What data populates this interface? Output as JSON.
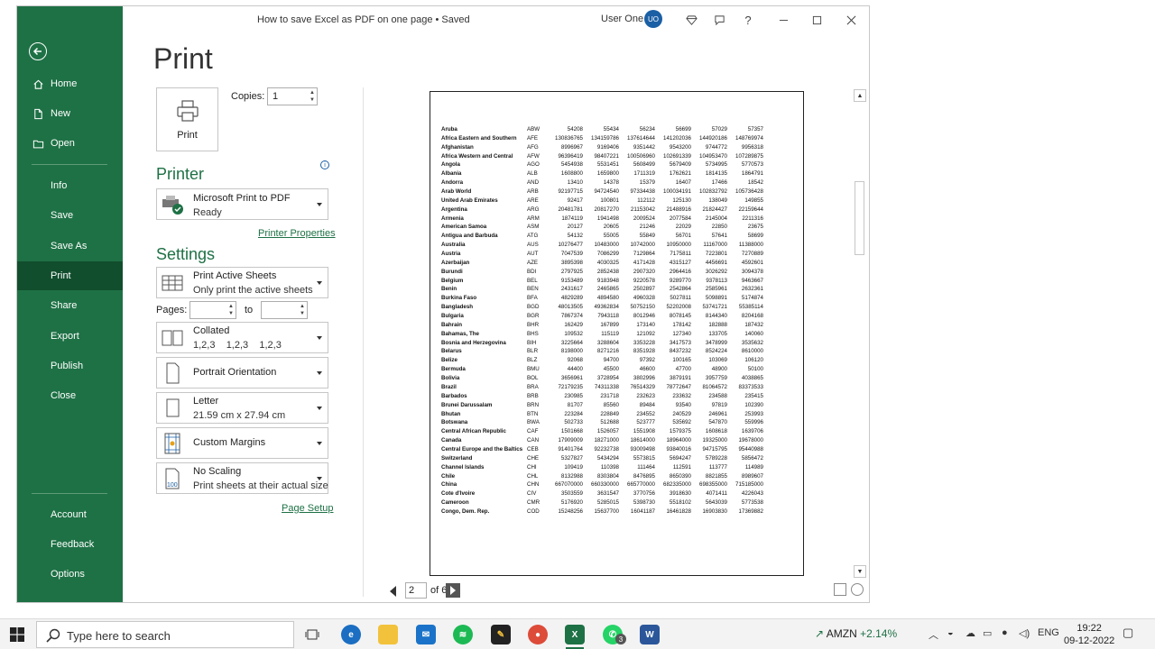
{
  "window": {
    "doc_title": "How to save Excel as PDF on one page • Saved",
    "user_name": "User One",
    "user_initials": "UO"
  },
  "sidebar": {
    "items": [
      {
        "label": "Home",
        "icon": "home-icon"
      },
      {
        "label": "New",
        "icon": "new-document-icon"
      },
      {
        "label": "Open",
        "icon": "folder-icon"
      },
      {
        "label": "Info"
      },
      {
        "label": "Save"
      },
      {
        "label": "Save As"
      },
      {
        "label": "Print"
      },
      {
        "label": "Share"
      },
      {
        "label": "Export"
      },
      {
        "label": "Publish"
      },
      {
        "label": "Close"
      }
    ],
    "bottom": [
      {
        "label": "Account"
      },
      {
        "label": "Feedback"
      },
      {
        "label": "Options"
      }
    ],
    "accent": "#1e7145"
  },
  "print": {
    "heading": "Print",
    "button_label": "Print",
    "copies_label": "Copies:",
    "copies_value": "1",
    "printer_heading": "Printer",
    "printer_name": "Microsoft Print to PDF",
    "printer_status": "Ready",
    "printer_properties": "Printer Properties",
    "settings_heading": "Settings",
    "what": {
      "title": "Print Active Sheets",
      "sub": "Only print the active sheets"
    },
    "pages_label": "Pages:",
    "pages_from": "",
    "to_label": "to",
    "pages_to": "",
    "collation": {
      "title": "Collated",
      "sub": "1,2,3    1,2,3    1,2,3"
    },
    "orientation": "Portrait Orientation",
    "paper": {
      "title": "Letter",
      "sub": "21.59 cm x 27.94 cm"
    },
    "margins": "Custom Margins",
    "scaling": {
      "title": "No Scaling",
      "sub": "Print sheets at their actual size"
    },
    "page_setup": "Page Setup"
  },
  "preview": {
    "current_page": "2",
    "of_label": "of 6",
    "rows": [
      [
        "Aruba",
        "ABW",
        "54208",
        "55434",
        "56234",
        "56699",
        "57029",
        "57357"
      ],
      [
        "Africa Eastern and Southern",
        "AFE",
        "130836765",
        "134159786",
        "137614644",
        "141202036",
        "144920186",
        "148769974"
      ],
      [
        "Afghanistan",
        "AFG",
        "8996967",
        "9169406",
        "9351442",
        "9543200",
        "9744772",
        "9956318"
      ],
      [
        "Africa Western and Central",
        "AFW",
        "96396419",
        "98407221",
        "100506960",
        "102691339",
        "104953470",
        "107289875"
      ],
      [
        "Angola",
        "AGO",
        "5454938",
        "5531451",
        "5608499",
        "5679409",
        "5734995",
        "5770573"
      ],
      [
        "Albania",
        "ALB",
        "1608800",
        "1659800",
        "1711319",
        "1762621",
        "1814135",
        "1864791"
      ],
      [
        "Andorra",
        "AND",
        "13410",
        "14378",
        "15379",
        "16407",
        "17466",
        "18542"
      ],
      [
        "Arab World",
        "ARB",
        "92197715",
        "94724540",
        "97334438",
        "100034191",
        "102832792",
        "105736428"
      ],
      [
        "United Arab Emirates",
        "ARE",
        "92417",
        "100801",
        "112112",
        "125130",
        "138049",
        "149855"
      ],
      [
        "Argentina",
        "ARG",
        "20481781",
        "20817270",
        "21153042",
        "21488916",
        "21824427",
        "22159644"
      ],
      [
        "Armenia",
        "ARM",
        "1874119",
        "1941498",
        "2009524",
        "2077584",
        "2145004",
        "2211316"
      ],
      [
        "American Samoa",
        "ASM",
        "20127",
        "20605",
        "21246",
        "22029",
        "22850",
        "23675"
      ],
      [
        "Antigua and Barbuda",
        "ATG",
        "54132",
        "55005",
        "55849",
        "56701",
        "57641",
        "58699"
      ],
      [
        "Australia",
        "AUS",
        "10276477",
        "10483000",
        "10742000",
        "10950000",
        "11167000",
        "11388000"
      ],
      [
        "Austria",
        "AUT",
        "7047539",
        "7086299",
        "7129864",
        "7175811",
        "7223801",
        "7270889"
      ],
      [
        "Azerbaijan",
        "AZE",
        "3895398",
        "4030325",
        "4171428",
        "4315127",
        "4456691",
        "4592601"
      ],
      [
        "Burundi",
        "BDI",
        "2797925",
        "2852438",
        "2907320",
        "2964416",
        "3026292",
        "3094378"
      ],
      [
        "Belgium",
        "BEL",
        "9153489",
        "9183948",
        "9220578",
        "9289770",
        "9378113",
        "9463667"
      ],
      [
        "Benin",
        "BEN",
        "2431617",
        "2465865",
        "2502897",
        "2542864",
        "2585961",
        "2632361"
      ],
      [
        "Burkina Faso",
        "BFA",
        "4829289",
        "4894580",
        "4960328",
        "5027811",
        "5098891",
        "5174874"
      ],
      [
        "Bangladesh",
        "BGD",
        "48013505",
        "49362834",
        "50752150",
        "52202008",
        "53741721",
        "55385114"
      ],
      [
        "Bulgaria",
        "BGR",
        "7867374",
        "7943118",
        "8012946",
        "8078145",
        "8144340",
        "8204168"
      ],
      [
        "Bahrain",
        "BHR",
        "162429",
        "167899",
        "173140",
        "178142",
        "182888",
        "187432"
      ],
      [
        "Bahamas, The",
        "BHS",
        "109532",
        "115119",
        "121092",
        "127340",
        "133705",
        "140060"
      ],
      [
        "Bosnia and Herzegovina",
        "BIH",
        "3225664",
        "3288604",
        "3353228",
        "3417573",
        "3478999",
        "3535632"
      ],
      [
        "Belarus",
        "BLR",
        "8198000",
        "8271216",
        "8351928",
        "8437232",
        "8524224",
        "8610000"
      ],
      [
        "Belize",
        "BLZ",
        "92068",
        "94700",
        "97392",
        "100165",
        "103069",
        "106120"
      ],
      [
        "Bermuda",
        "BMU",
        "44400",
        "45500",
        "46600",
        "47700",
        "48900",
        "50100"
      ],
      [
        "Bolivia",
        "BOL",
        "3656961",
        "3728954",
        "3802996",
        "3879191",
        "3957759",
        "4038865"
      ],
      [
        "Brazil",
        "BRA",
        "72179235",
        "74311338",
        "76514329",
        "78772647",
        "81064572",
        "83373533"
      ],
      [
        "Barbados",
        "BRB",
        "230985",
        "231718",
        "232623",
        "233632",
        "234588",
        "235415"
      ],
      [
        "Brunei Darussalam",
        "BRN",
        "81707",
        "85560",
        "89484",
        "93540",
        "97819",
        "102390"
      ],
      [
        "Bhutan",
        "BTN",
        "223284",
        "228849",
        "234552",
        "240529",
        "246961",
        "253993"
      ],
      [
        "Botswana",
        "BWA",
        "502733",
        "512688",
        "523777",
        "535692",
        "547870",
        "559996"
      ],
      [
        "Central African Republic",
        "CAF",
        "1501668",
        "1526057",
        "1551908",
        "1579375",
        "1608618",
        "1639706"
      ],
      [
        "Canada",
        "CAN",
        "17909009",
        "18271000",
        "18614000",
        "18964000",
        "19325000",
        "19678000"
      ],
      [
        "Central Europe and the Baltics",
        "CEB",
        "91401764",
        "92232738",
        "93009498",
        "93840016",
        "94715795",
        "95440988"
      ],
      [
        "Switzerland",
        "CHE",
        "5327827",
        "5434294",
        "5573815",
        "5694247",
        "5789228",
        "5856472"
      ],
      [
        "Channel Islands",
        "CHI",
        "109419",
        "110398",
        "111464",
        "112591",
        "113777",
        "114989"
      ],
      [
        "Chile",
        "CHL",
        "8132988",
        "8303804",
        "8476895",
        "8650390",
        "8821855",
        "8989607"
      ],
      [
        "China",
        "CHN",
        "667070000",
        "660330000",
        "665770000",
        "682335000",
        "698355000",
        "715185000"
      ],
      [
        "Cote d'Ivoire",
        "CIV",
        "3503559",
        "3631547",
        "3770756",
        "3918630",
        "4071411",
        "4226043"
      ],
      [
        "Cameroon",
        "CMR",
        "5176920",
        "5285015",
        "5398730",
        "5518102",
        "5643039",
        "5773538"
      ],
      [
        "Congo, Dem. Rep.",
        "COD",
        "15248256",
        "15637700",
        "16041187",
        "16461828",
        "16903830",
        "17369882"
      ]
    ]
  },
  "taskbar": {
    "search_placeholder": "Type here to search",
    "stock_ticker": "AMZN",
    "stock_change": "+2.14%",
    "language": "ENG",
    "time": "19:22",
    "date": "09-12-2022",
    "whatsapp_badge": "3"
  }
}
